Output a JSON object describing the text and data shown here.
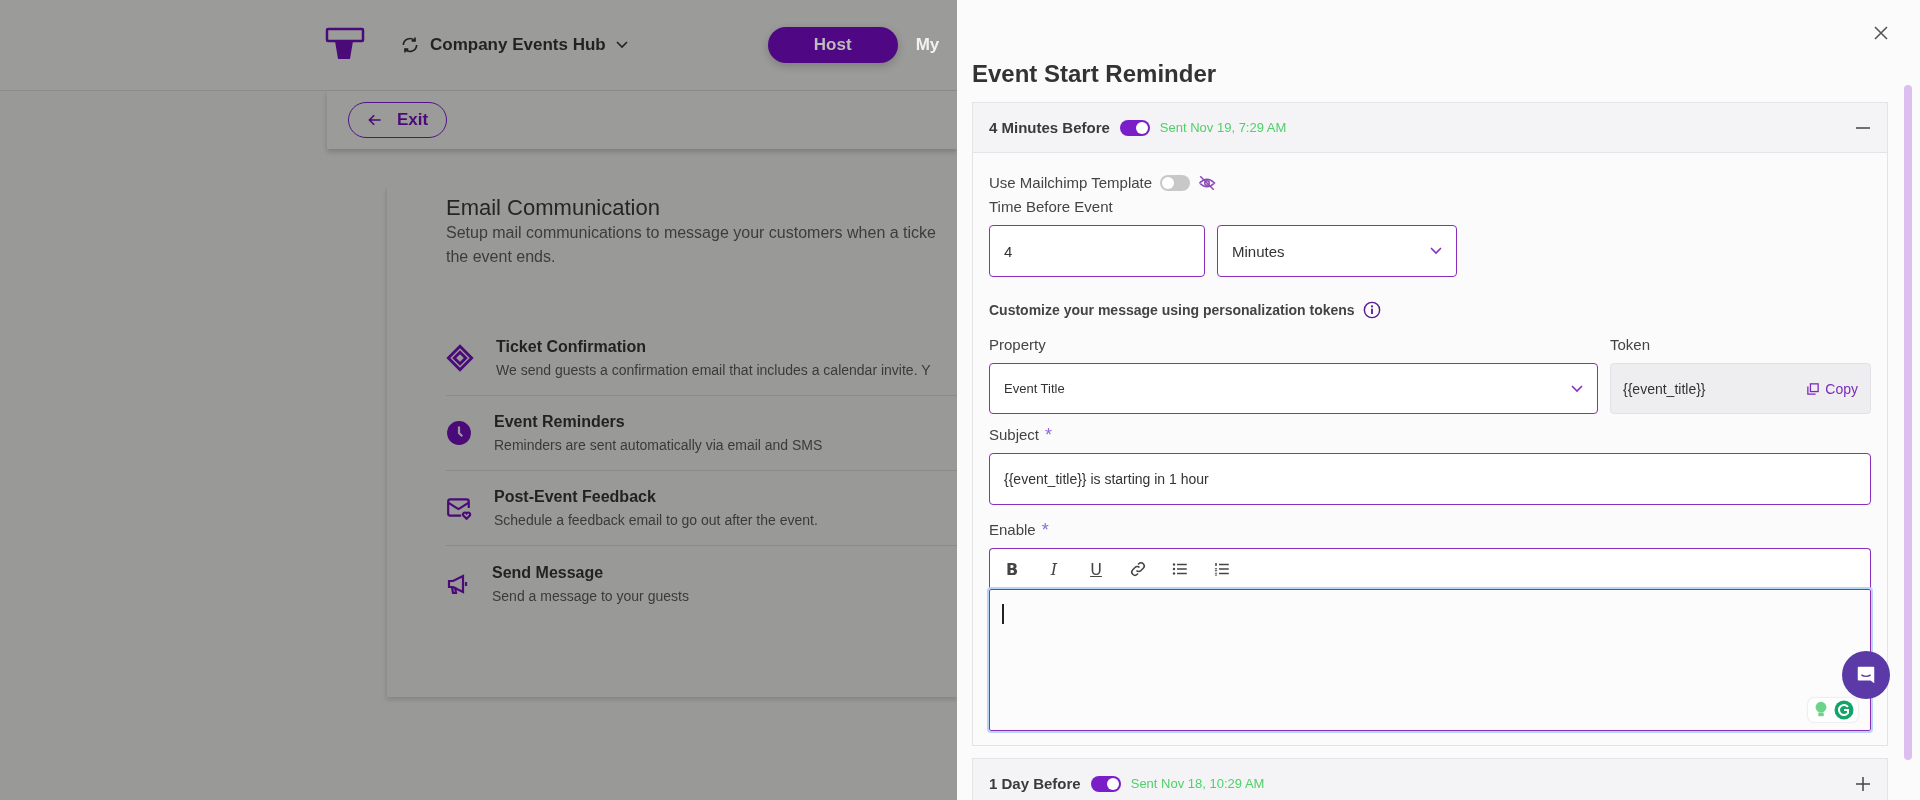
{
  "header": {
    "brand": "Company Events Hub",
    "tabs": [
      {
        "label": "Host",
        "selected": true
      },
      {
        "label": "My",
        "selected": false
      }
    ]
  },
  "exit_button": "Exit",
  "email_section": {
    "title": "Email Communication",
    "description_lines": [
      "Setup mail communications to message your customers when a ticke",
      "the event ends."
    ],
    "items": [
      {
        "kind": "ticket",
        "title": "Ticket Confirmation",
        "description": "We send guests a confirmation email that includes a calendar invite. Y"
      },
      {
        "kind": "clock",
        "title": "Event Reminders",
        "description": "Reminders are sent automatically via email and SMS"
      },
      {
        "kind": "feedback",
        "title": "Post-Event Feedback",
        "description": "Schedule a feedback email to go out after the event."
      },
      {
        "kind": "megaphone",
        "title": "Send Message",
        "description": "Send a message to your guests"
      }
    ]
  },
  "drawer": {
    "title": "Event Start Reminder",
    "reminders": [
      {
        "label": "4 Minutes Before",
        "on": true,
        "sent": "Sent Nov 19, 7:29 AM",
        "expanded": true
      },
      {
        "label": "1 Day Before",
        "on": true,
        "sent": "Sent Nov 18, 10:29 AM",
        "expanded": false
      }
    ],
    "form": {
      "mailchimp_label": "Use Mailchimp Template",
      "mailchimp_on": false,
      "time_label": "Time Before Event",
      "time_value": "4",
      "time_unit": "Minutes",
      "customize_label": "Customize your message using personalization tokens",
      "property_label": "Property",
      "property_value": "Event Title",
      "token_label": "Token",
      "token_value": "{{event_title}}",
      "copy": "Copy",
      "subject_label": "Subject",
      "subject_mark": "*",
      "subject_value": "{{event_title}} is starting in 1 hour",
      "body_label": "Enable",
      "body_mark": "*",
      "toolbar": [
        {
          "kind": "bold",
          "glyph": "B"
        },
        {
          "kind": "italic",
          "glyph": "I"
        },
        {
          "kind": "underline",
          "glyph": "U"
        },
        {
          "kind": "link"
        },
        {
          "kind": "bullets"
        },
        {
          "kind": "numbers"
        }
      ]
    }
  }
}
